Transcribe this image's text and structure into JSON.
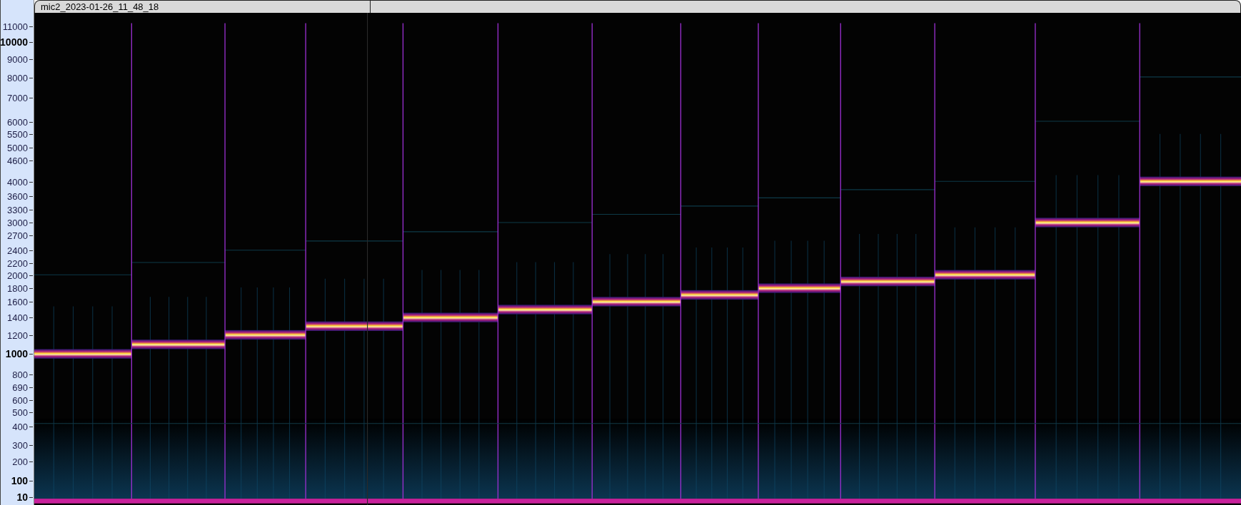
{
  "track": {
    "title": "mic2_2023-01-26_11_48_18"
  },
  "axis": {
    "ticks": [
      {
        "label": "11000",
        "major": false
      },
      {
        "label": "10000",
        "major": true
      },
      {
        "label": "9000",
        "major": false
      },
      {
        "label": "8000",
        "major": false
      },
      {
        "label": "7000",
        "major": false
      },
      {
        "label": "6000",
        "major": false
      },
      {
        "label": "5500",
        "major": false
      },
      {
        "label": "5000",
        "major": false
      },
      {
        "label": "4600",
        "major": false
      },
      {
        "label": "4000",
        "major": false
      },
      {
        "label": "3600",
        "major": false
      },
      {
        "label": "3300",
        "major": false
      },
      {
        "label": "3000",
        "major": false
      },
      {
        "label": "2700",
        "major": false
      },
      {
        "label": "2400",
        "major": false
      },
      {
        "label": "2200",
        "major": false
      },
      {
        "label": "2000",
        "major": false
      },
      {
        "label": "1800",
        "major": false
      },
      {
        "label": "1600",
        "major": false
      },
      {
        "label": "1400",
        "major": false
      },
      {
        "label": "1200",
        "major": false
      },
      {
        "label": "1000",
        "major": true
      },
      {
        "label": "800",
        "major": false
      },
      {
        "label": "690",
        "major": false
      },
      {
        "label": "600",
        "major": false
      },
      {
        "label": "500",
        "major": false
      },
      {
        "label": "400",
        "major": false
      },
      {
        "label": "300",
        "major": false
      },
      {
        "label": "200",
        "major": false
      },
      {
        "label": "100",
        "major": true
      },
      {
        "label": "10",
        "major": true
      }
    ]
  }
}
